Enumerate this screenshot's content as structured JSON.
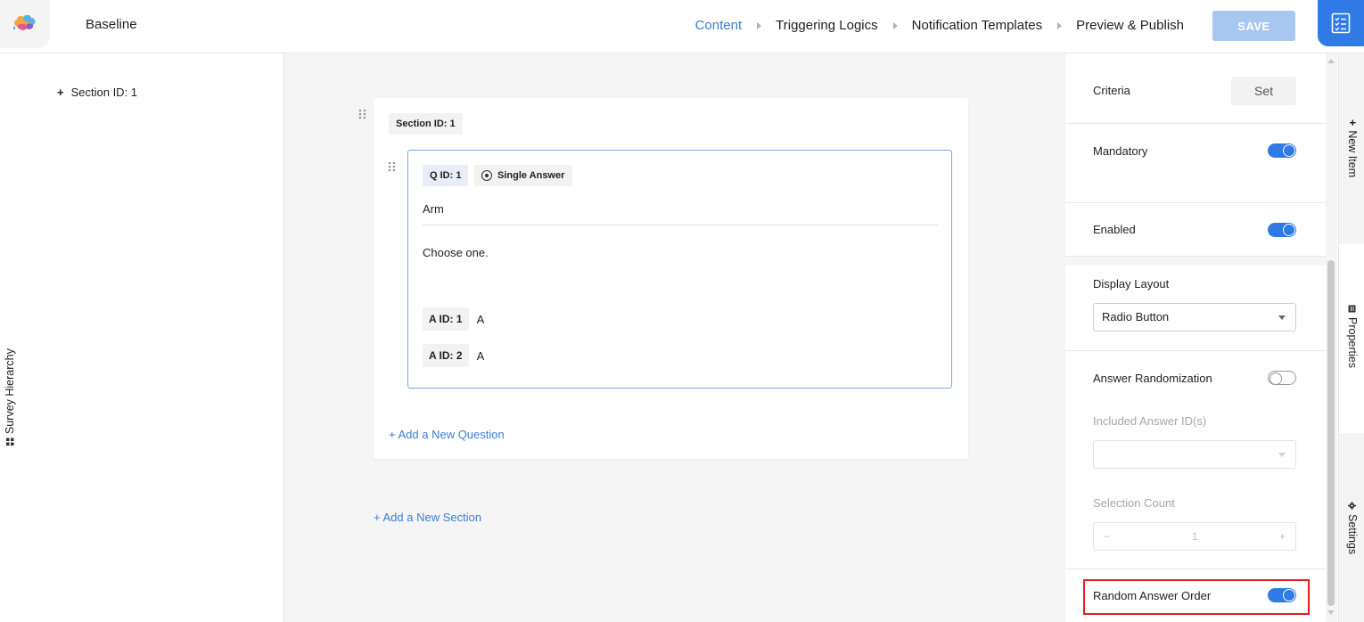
{
  "header": {
    "survey_title": "Baseline",
    "nav": [
      {
        "label": "Content",
        "active": true
      },
      {
        "label": "Triggering Logics",
        "active": false
      },
      {
        "label": "Notification Templates",
        "active": false
      },
      {
        "label": "Preview & Publish",
        "active": false
      }
    ],
    "save_label": "SAVE",
    "corner_icon": "checklist-icon",
    "logo_icon": "brain-logo-icon"
  },
  "hierarchy": {
    "tab_label": "Survey Hierarchy",
    "items": [
      {
        "label": "Section ID: 1"
      }
    ]
  },
  "canvas": {
    "section": {
      "badge": "Section ID: 1",
      "question": {
        "qid": "Q ID: 1",
        "type": "Single Answer",
        "title": "Arm",
        "instruction": "Choose one.",
        "answers": [
          {
            "id": "A ID: 1",
            "text": "A"
          },
          {
            "id": "A ID: 2",
            "text": "A"
          }
        ]
      },
      "add_question": "+ Add a New Question"
    },
    "add_section": "+ Add a New Section"
  },
  "properties": {
    "criteria_label": "Criteria",
    "set_label": "Set",
    "mandatory_label": "Mandatory",
    "mandatory_on": true,
    "enabled_label": "Enabled",
    "enabled_on": true,
    "display_layout_label": "Display Layout",
    "display_layout_value": "Radio Button",
    "answer_randomization_label": "Answer Randomization",
    "answer_randomization_on": false,
    "included_answers_label": "Included Answer ID(s)",
    "included_answers_value": "",
    "selection_count_label": "Selection Count",
    "selection_count_minus": "−",
    "selection_count_value": "1",
    "selection_count_plus": "+",
    "random_order_label": "Random Answer Order",
    "random_order_on": true
  },
  "side_tabs": {
    "new_item": "New Item",
    "properties": "Properties",
    "settings": "Settings"
  },
  "colors": {
    "accent": "#2f7ae5",
    "link": "#3b7dd8",
    "save_disabled": "#a8c7f0",
    "highlight": "#e01e1e"
  }
}
